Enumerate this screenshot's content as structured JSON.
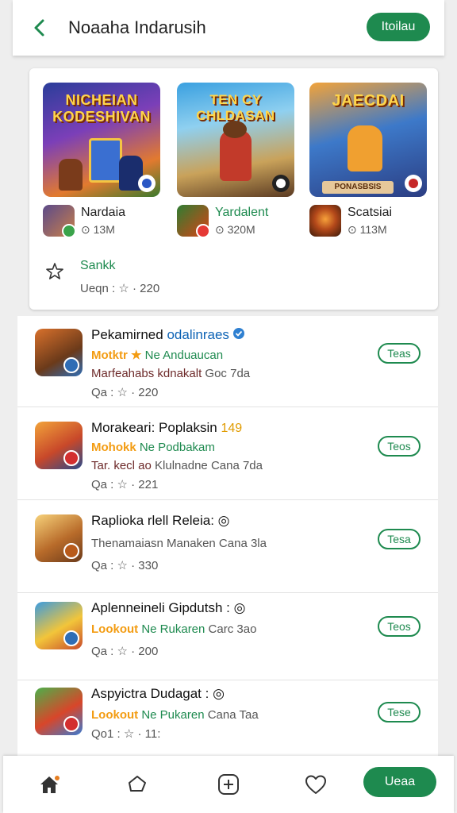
{
  "header": {
    "title": "Noaaha Indarusih",
    "pill_label": "Itoilau"
  },
  "featured": {
    "cards": [
      {
        "art_title": "NICHEIAN KODESHIVAN",
        "name": "Nardaia",
        "size": "⊙ 13M"
      },
      {
        "art_title": "TEN CY CHLDASAN",
        "name": "Yardalent",
        "size": "⊙ 320M"
      },
      {
        "art_title": "JAECDAI",
        "art_footer": "PONASBSIS",
        "name": "Scatsiai",
        "size": "⊙ 113M"
      }
    ],
    "more_label": "Sankk",
    "more_sub": "Ueqn : ☆ · 220"
  },
  "list": [
    {
      "title": "Pekamirned",
      "title_suffix": "odalinraes",
      "line2_orange": "Motktr ★",
      "line2_green": "Ne Anduaucan",
      "line3": "Marfeahabs kdnakalt",
      "line3_grey": "Goc 7da",
      "meta": "Qa : ☆ · 220",
      "button": "Teas"
    },
    {
      "title": "Morakeari: Poplaksin",
      "title_gold": "149",
      "line2_orange": "Mohokk",
      "line2_green": "Ne Podbakam",
      "line3": "Tar. kecl ao",
      "line3_grey": "Klulnadne Cana 7da",
      "meta": "Qa : ☆ · 221",
      "button": "Teos"
    },
    {
      "title": "Raplioka rlell Releia: ◎",
      "line3_grey": "Thenamaiasn Manaken Cana 3la",
      "meta": "Qa : ☆ · 330",
      "button": "Tesa"
    },
    {
      "title": "Aplenneineli Gipdutsh : ◎",
      "line2_orange": "Lookout",
      "line2_green": "Ne Rukaren",
      "line3_grey": "Carc 3ao",
      "meta": "Qa : ☆ · 200",
      "button": "Teos"
    },
    {
      "title": "Aspyictra Dudagat : ◎",
      "line2_orange": "Lookout",
      "line2_green": "Ne Pukaren",
      "line3_grey": "Cana Taa",
      "meta": "Qo1 : ☆ · 11:",
      "button": "Tese"
    }
  ],
  "bottom_nav": {
    "cta_label": "Ueaa"
  }
}
